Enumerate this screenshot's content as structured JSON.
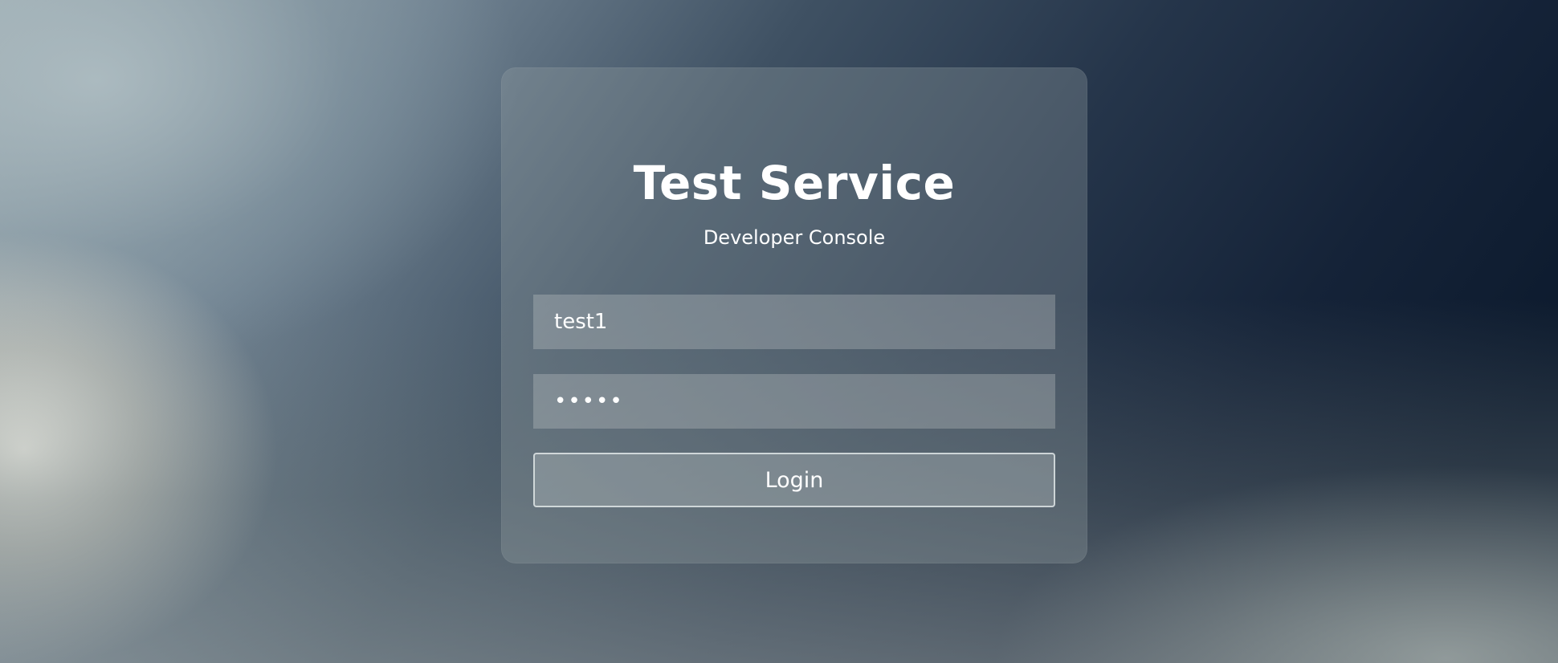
{
  "login": {
    "title": "Test Service",
    "subtitle": "Developer Console",
    "username_value": "test1",
    "password_value": "•••••",
    "login_label": "Login"
  }
}
